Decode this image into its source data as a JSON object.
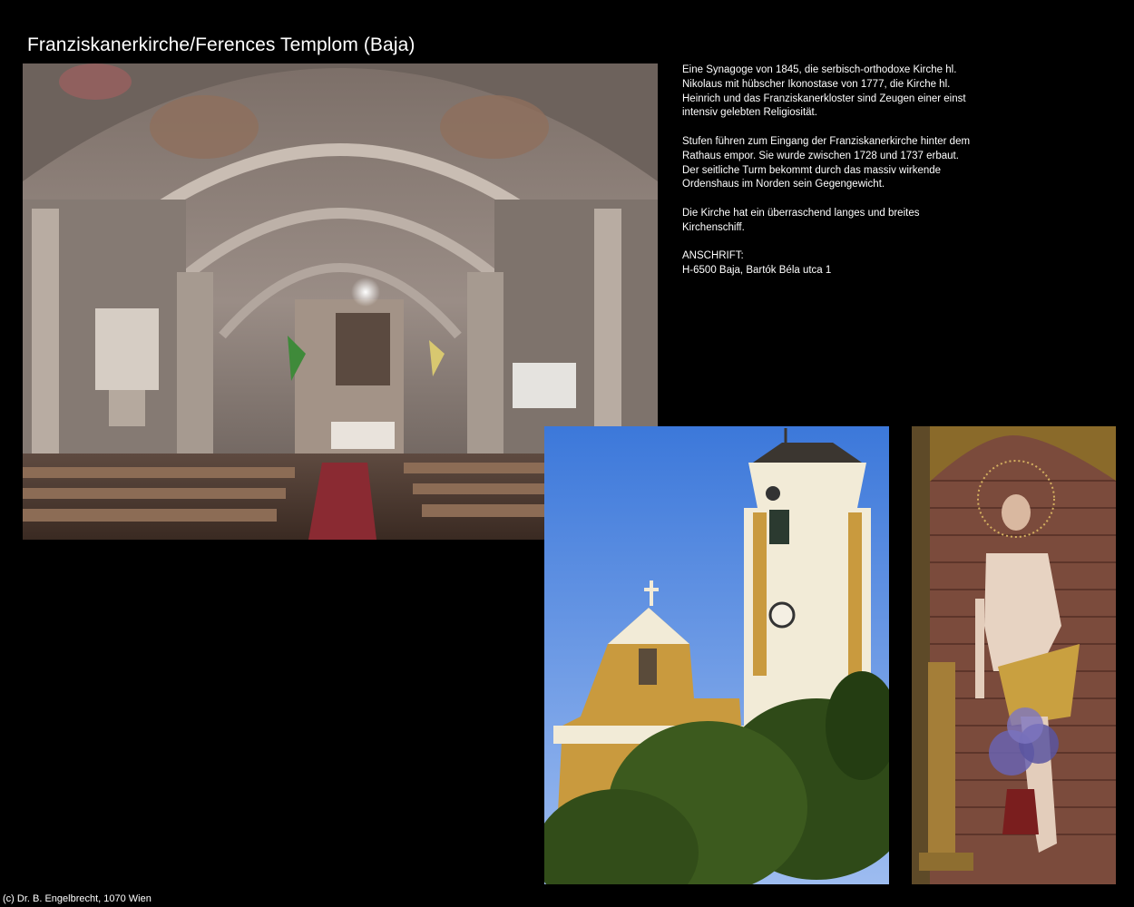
{
  "page": {
    "title": "Franziskanerkirche/Ferences Templom (Baja)",
    "footer": "(c) Dr. B. Engelbrecht, 1070 Wien"
  },
  "description": {
    "paragraphs": [
      "Eine Synagoge von 1845, die serbisch-orthodoxe Kirche hl. Nikolaus mit hübscher Ikonostase von 1777, die Kirche hl. Heinrich und das Franziskanerkloster sind Zeugen einer einst intensiv gelebten Religiosität.",
      "Stufen führen zum Eingang der Franziskanerkirche hinter dem Rathaus empor. Sie wurde zwischen 1728 und 1737 erbaut. Der seitliche Turm bekommt durch das massiv wirkende Ordenshaus im Norden sein Gegengewicht.",
      "Die Kirche hat ein überraschend langes und breites Kirchenschiff."
    ],
    "address_label": "ANSCHRIFT:",
    "address": "H-6500 Baja, Bartók Béla utca 1"
  },
  "colors": {
    "background": "#000000",
    "text": "#ffffff",
    "sky": "#5f8fe0",
    "facade": "#c99a3e"
  }
}
